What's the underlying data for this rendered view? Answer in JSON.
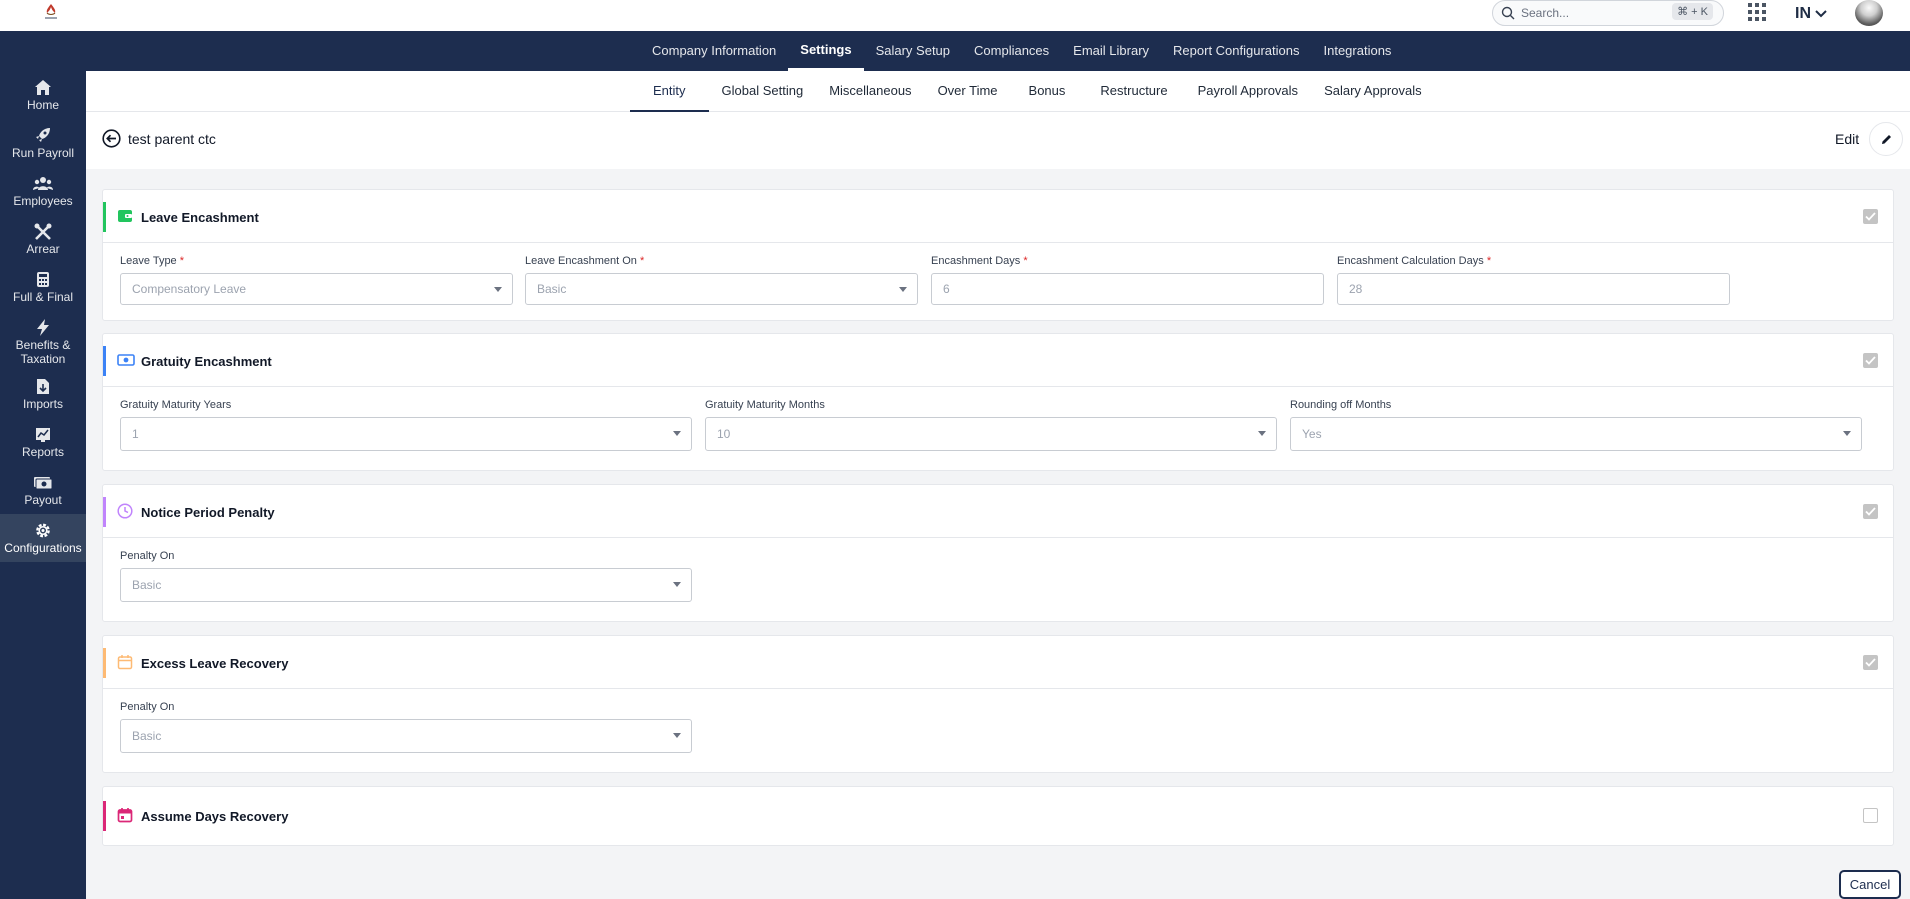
{
  "header": {
    "search_placeholder": "Search...",
    "search_shortcut": "⌘ + K",
    "language": "IN"
  },
  "main_nav": {
    "tabs": [
      "Company Information",
      "Settings",
      "Salary Setup",
      "Compliances",
      "Email Library",
      "Report Configurations",
      "Integrations"
    ],
    "active": "Settings"
  },
  "sidebar": {
    "items": [
      {
        "label": "Home",
        "icon": "home-icon"
      },
      {
        "label": "Run Payroll",
        "icon": "rocket-icon"
      },
      {
        "label": "Employees",
        "icon": "users-icon"
      },
      {
        "label": "Arrear",
        "icon": "tools-icon"
      },
      {
        "label": "Full & Final",
        "icon": "calculator-icon"
      },
      {
        "label": "Benefits & Taxation",
        "icon": "bolt-icon"
      },
      {
        "label": "Imports",
        "icon": "file-import-icon"
      },
      {
        "label": "Reports",
        "icon": "chart-icon"
      },
      {
        "label": "Payout",
        "icon": "money-icon"
      },
      {
        "label": "Configurations",
        "icon": "gear-icon"
      }
    ],
    "active": "Configurations"
  },
  "sub_nav": {
    "tabs": [
      "Entity",
      "Global Setting",
      "Miscellaneous",
      "Over Time",
      "Bonus",
      "Restructure",
      "Payroll Approvals",
      "Salary Approvals"
    ],
    "active": "Entity"
  },
  "page": {
    "title": "test parent ctc",
    "edit_label": "Edit"
  },
  "sections": {
    "leave_encashment": {
      "title": "Leave Encashment",
      "accent": "#22c55e",
      "fields": [
        {
          "label": "Leave Type",
          "value": "Compensatory Leave"
        },
        {
          "label": "Leave Encashment On",
          "value": "Basic"
        },
        {
          "label": "Encashment Days",
          "value": "6"
        },
        {
          "label": "Encashment Calculation Days",
          "value": "28"
        }
      ]
    },
    "gratuity_encashment": {
      "title": "Gratuity Encashment",
      "accent": "#3b82f6",
      "fields": [
        {
          "label": "Gratuity Maturity Years",
          "value": "1"
        },
        {
          "label": "Gratuity Maturity Months",
          "value": "10"
        },
        {
          "label": "Rounding off Months",
          "value": "Yes"
        }
      ]
    },
    "notice_period_penalty": {
      "title": "Notice Period Penalty",
      "accent": "#c084fc",
      "fields": [
        {
          "label": "Penalty On",
          "value": "Basic"
        }
      ]
    },
    "excess_leave_recovery": {
      "title": "Excess Leave Recovery",
      "accent": "#fdba74",
      "fields": [
        {
          "label": "Penalty On",
          "value": "Basic"
        }
      ]
    },
    "assume_days_recovery": {
      "title": "Assume Days Recovery",
      "accent": "#db2777"
    }
  },
  "footer": {
    "cancel_label": "Cancel"
  }
}
